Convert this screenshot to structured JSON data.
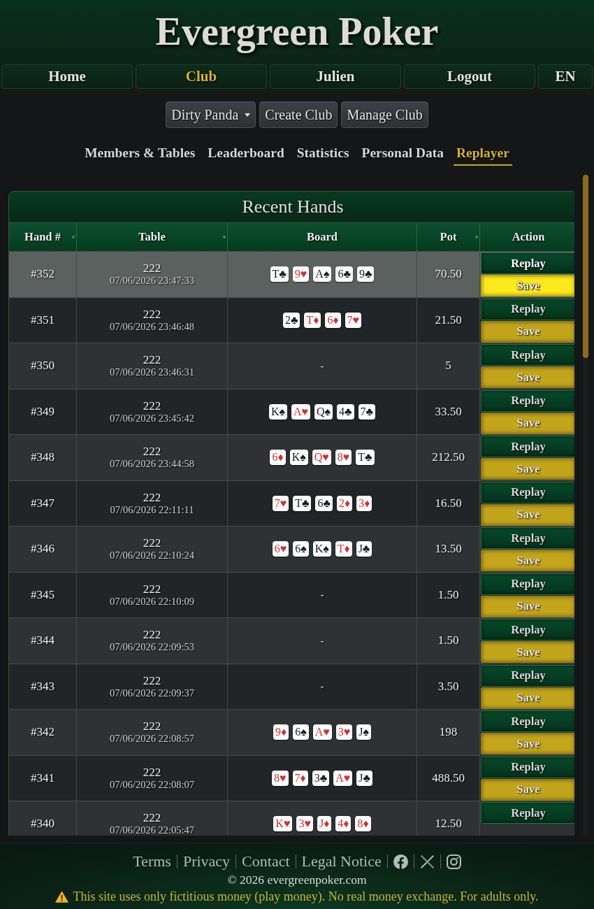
{
  "site": {
    "title": "Evergreen Poker"
  },
  "nav": {
    "items": [
      {
        "label": "Home",
        "selected": false
      },
      {
        "label": "Club",
        "selected": true
      },
      {
        "label": "Julien",
        "selected": false
      },
      {
        "label": "Logout",
        "selected": false
      },
      {
        "label": "EN",
        "selected": false
      }
    ]
  },
  "club_bar": {
    "dropdown": {
      "label": "Dirty Panda"
    },
    "buttons": [
      "Create Club",
      "Manage Club"
    ]
  },
  "tabs": [
    {
      "label": "Members & Tables",
      "selected": false
    },
    {
      "label": "Leaderboard",
      "selected": false
    },
    {
      "label": "Statistics",
      "selected": false
    },
    {
      "label": "Personal Data",
      "selected": false
    },
    {
      "label": "Replayer",
      "selected": true
    }
  ],
  "hands_panel": {
    "title": "Recent Hands",
    "columns": [
      {
        "label": "Hand #",
        "sortable": true
      },
      {
        "label": "Table",
        "sortable": true
      },
      {
        "label": "Board",
        "sortable": false
      },
      {
        "label": "Pot",
        "sortable": true
      },
      {
        "label": "Action",
        "sortable": false
      }
    ],
    "rows": [
      {
        "hand": "#352",
        "table": "222",
        "time": "07/06/2026 23:47:33",
        "board": [
          {
            "card": "T♣",
            "color": "#1b1b1b"
          },
          {
            "card": "9♥",
            "color": "#d32f2f"
          },
          {
            "card": "A♠",
            "color": "#1b1b1b"
          },
          {
            "card": "6♣",
            "color": "#1b1b1b"
          },
          {
            "card": "9♣",
            "color": "#1b1b1b"
          }
        ],
        "pot": "70.50",
        "actions": [
          {
            "kind": "replay",
            "label": "Replay"
          },
          {
            "kind": "save",
            "label": "Save"
          }
        ],
        "selected": true
      },
      {
        "hand": "#351",
        "table": "222",
        "time": "07/06/2026 23:46:48",
        "board": [
          {
            "card": "2♣",
            "color": "#1b1b1b"
          },
          {
            "card": "T♦",
            "color": "#d32f2f"
          },
          {
            "card": "6♦",
            "color": "#d32f2f"
          },
          {
            "card": "7♥",
            "color": "#d32f2f"
          }
        ],
        "pot": "21.50",
        "actions": [
          {
            "kind": "replay",
            "label": "Replay"
          },
          {
            "kind": "save",
            "label": "Save"
          }
        ],
        "selected": false
      },
      {
        "hand": "#350",
        "table": "222",
        "time": "07/06/2026 23:46:31",
        "board_text": "-",
        "pot": "5",
        "actions": [
          {
            "kind": "replay",
            "label": "Replay"
          },
          {
            "kind": "save",
            "label": "Save"
          }
        ],
        "selected": false
      },
      {
        "hand": "#349",
        "table": "222",
        "time": "07/06/2026 23:45:42",
        "board": [
          {
            "card": "K♠",
            "color": "#1b1b1b"
          },
          {
            "card": "A♥",
            "color": "#d32f2f"
          },
          {
            "card": "Q♠",
            "color": "#1b1b1b"
          },
          {
            "card": "4♣",
            "color": "#1b1b1b"
          },
          {
            "card": "7♣",
            "color": "#1b1b1b"
          }
        ],
        "pot": "33.50",
        "actions": [
          {
            "kind": "replay",
            "label": "Replay"
          },
          {
            "kind": "save",
            "label": "Save"
          }
        ],
        "selected": false
      },
      {
        "hand": "#348",
        "table": "222",
        "time": "07/06/2026 23:44:58",
        "board": [
          {
            "card": "6♦",
            "color": "#d32f2f"
          },
          {
            "card": "K♠",
            "color": "#1b1b1b"
          },
          {
            "card": "Q♥",
            "color": "#d32f2f"
          },
          {
            "card": "8♥",
            "color": "#d32f2f"
          },
          {
            "card": "T♣",
            "color": "#1b1b1b"
          }
        ],
        "pot": "212.50",
        "actions": [
          {
            "kind": "replay",
            "label": "Replay"
          },
          {
            "kind": "save",
            "label": "Save"
          }
        ],
        "selected": false
      },
      {
        "hand": "#347",
        "table": "222",
        "time": "07/06/2026 22:11:11",
        "board": [
          {
            "card": "7♥",
            "color": "#d32f2f"
          },
          {
            "card": "T♣",
            "color": "#1b1b1b"
          },
          {
            "card": "6♣",
            "color": "#1b1b1b"
          },
          {
            "card": "2♦",
            "color": "#d32f2f"
          },
          {
            "card": "3♦",
            "color": "#d32f2f"
          }
        ],
        "pot": "16.50",
        "actions": [
          {
            "kind": "replay",
            "label": "Replay"
          },
          {
            "kind": "save",
            "label": "Save"
          }
        ],
        "selected": false
      },
      {
        "hand": "#346",
        "table": "222",
        "time": "07/06/2026 22:10:24",
        "board": [
          {
            "card": "6♥",
            "color": "#d32f2f"
          },
          {
            "card": "6♠",
            "color": "#1b1b1b"
          },
          {
            "card": "K♠",
            "color": "#1b1b1b"
          },
          {
            "card": "T♦",
            "color": "#d32f2f"
          },
          {
            "card": "J♣",
            "color": "#1b1b1b"
          }
        ],
        "pot": "13.50",
        "actions": [
          {
            "kind": "replay",
            "label": "Replay"
          },
          {
            "kind": "save",
            "label": "Save"
          }
        ],
        "selected": false
      },
      {
        "hand": "#345",
        "table": "222",
        "time": "07/06/2026 22:10:09",
        "board_text": "-",
        "pot": "1.50",
        "actions": [
          {
            "kind": "replay",
            "label": "Replay"
          },
          {
            "kind": "save",
            "label": "Save"
          }
        ],
        "selected": false
      },
      {
        "hand": "#344",
        "table": "222",
        "time": "07/06/2026 22:09:53",
        "board_text": "-",
        "pot": "1.50",
        "actions": [
          {
            "kind": "replay",
            "label": "Replay"
          },
          {
            "kind": "save",
            "label": "Save"
          }
        ],
        "selected": false
      },
      {
        "hand": "#343",
        "table": "222",
        "time": "07/06/2026 22:09:37",
        "board_text": "-",
        "pot": "3.50",
        "actions": [
          {
            "kind": "replay",
            "label": "Replay"
          },
          {
            "kind": "save",
            "label": "Save"
          }
        ],
        "selected": false
      },
      {
        "hand": "#342",
        "table": "222",
        "time": "07/06/2026 22:08:57",
        "board": [
          {
            "card": "9♦",
            "color": "#d32f2f"
          },
          {
            "card": "6♠",
            "color": "#1b1b1b"
          },
          {
            "card": "A♥",
            "color": "#d32f2f"
          },
          {
            "card": "3♥",
            "color": "#d32f2f"
          },
          {
            "card": "J♠",
            "color": "#1b1b1b"
          }
        ],
        "pot": "198",
        "actions": [
          {
            "kind": "replay",
            "label": "Replay"
          },
          {
            "kind": "save",
            "label": "Save"
          }
        ],
        "selected": false
      },
      {
        "hand": "#341",
        "table": "222",
        "time": "07/06/2026 22:08:07",
        "board": [
          {
            "card": "8♥",
            "color": "#d32f2f"
          },
          {
            "card": "7♦",
            "color": "#d32f2f"
          },
          {
            "card": "3♣",
            "color": "#1b1b1b"
          },
          {
            "card": "A♥",
            "color": "#d32f2f"
          },
          {
            "card": "J♣",
            "color": "#1b1b1b"
          }
        ],
        "pot": "488.50",
        "actions": [
          {
            "kind": "replay",
            "label": "Replay"
          },
          {
            "kind": "save",
            "label": "Save"
          }
        ],
        "selected": false
      },
      {
        "hand": "#340",
        "table": "222",
        "time": "07/06/2026 22:05:47",
        "board": [
          {
            "card": "K♥",
            "color": "#d32f2f"
          },
          {
            "card": "3♥",
            "color": "#d32f2f"
          },
          {
            "card": "J♦",
            "color": "#d32f2f"
          },
          {
            "card": "4♦",
            "color": "#d32f2f"
          },
          {
            "card": "8♦",
            "color": "#d32f2f"
          }
        ],
        "pot": "12.50",
        "actions": [
          {
            "kind": "replay",
            "label": "Replay"
          }
        ],
        "selected": false
      }
    ]
  },
  "footer": {
    "links": [
      "Terms",
      "Privacy",
      "Contact",
      "Legal Notice"
    ],
    "copyright": "© 2026 evergreenpoker.com",
    "notice": "This site uses only fictitious money (play money). No real money exchange. For adults only."
  }
}
